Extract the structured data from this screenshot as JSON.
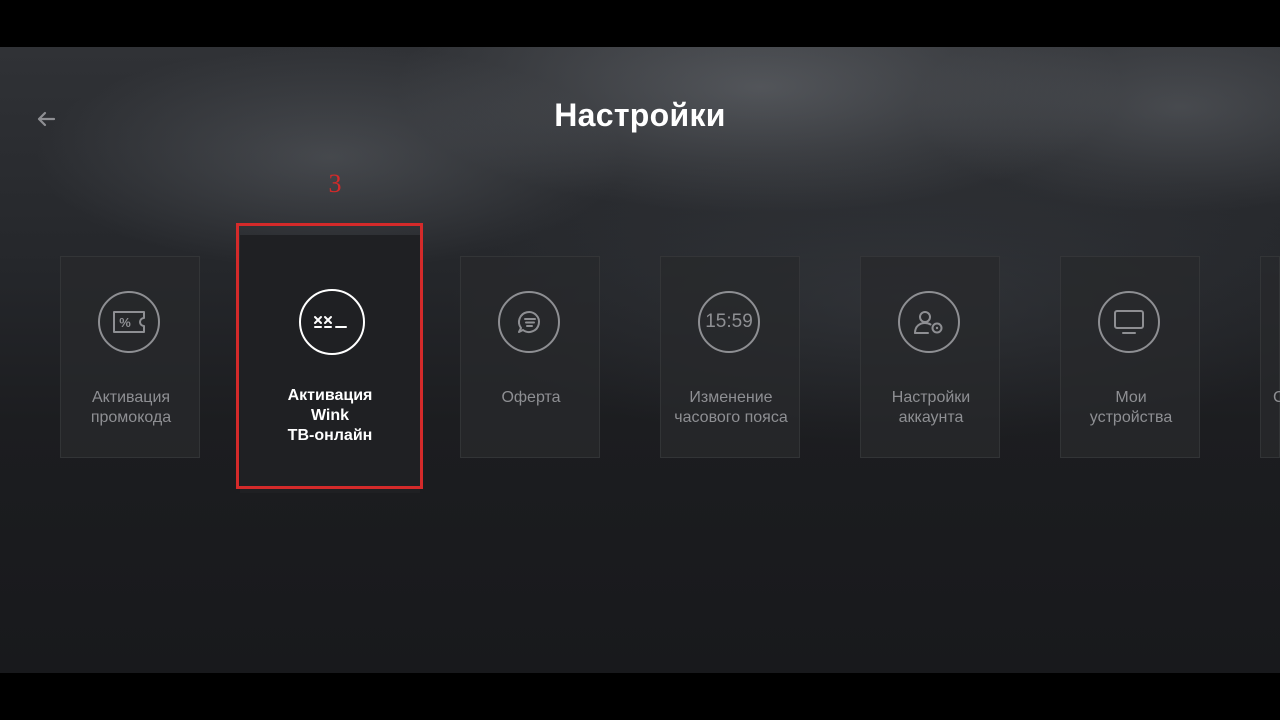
{
  "header": {
    "title": "Настройки"
  },
  "annotation": {
    "step_number": "3"
  },
  "tiles": [
    {
      "label": "Активация\nпромокода",
      "icon": "promo-ticket-icon",
      "active": false
    },
    {
      "label": "Активация\nWink\nТВ-онлайн",
      "icon": "tv-online-code-icon",
      "active": true
    },
    {
      "label": "Оферта",
      "icon": "offer-document-icon",
      "active": false
    },
    {
      "label": "Изменение\nчасового пояса",
      "icon": "clock-icon",
      "icon_text": "15:59",
      "active": false
    },
    {
      "label": "Настройки\nаккаунта",
      "icon": "account-settings-icon",
      "active": false
    },
    {
      "label": "Мои\nустройства",
      "icon": "devices-tv-icon",
      "active": false
    },
    {
      "label": "С",
      "icon": "",
      "active": false
    }
  ],
  "colors": {
    "highlight": "#d42a2a",
    "title": "#ffffff",
    "inactive_text": "#8e8f93"
  }
}
